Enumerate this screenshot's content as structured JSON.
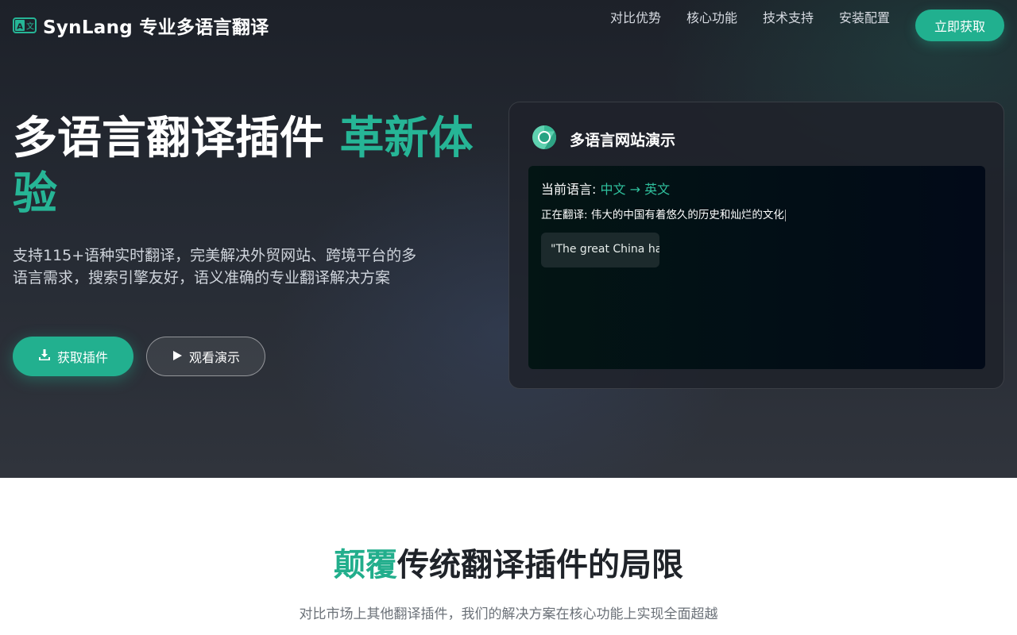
{
  "nav": {
    "brand": "SynLang 专业多语言翻译",
    "links": [
      "对比优势",
      "核心功能",
      "技术支持",
      "安装配置"
    ],
    "cta": "立即获取"
  },
  "hero": {
    "headline_main": "多语言翻译插件 ",
    "headline_accent": "革新体验",
    "subtext": "支持115+语种实时翻译，完美解决外贸网站、跨境平台的多语言需求，搜索引擎友好，语义准确的专业翻译解决方案",
    "primary_button": "获取插件",
    "secondary_button": "观看演示"
  },
  "demo": {
    "title": "多语言网站演示",
    "current_language_label": "当前语言: ",
    "source_language": "中文",
    "arrow": " → ",
    "target_language": "英文",
    "translating_label": "正在翻译: ",
    "translating_text": "伟大的中国有着悠久的历史和灿烂的文化",
    "output_text": "\"The great China ha"
  },
  "section": {
    "title_accent": "颠覆",
    "title_rest": "传统翻译插件的局限",
    "subtitle": "对比市场上其他翻译插件，我们的解决方案在核心功能上实现全面超越"
  },
  "colors": {
    "accent": "#22b08f",
    "hero_bg": "#252a33",
    "demo_screen_bg": "#031514"
  },
  "icons": [
    "translate-icon",
    "download-icon",
    "play-icon",
    "chrome-icon"
  ]
}
